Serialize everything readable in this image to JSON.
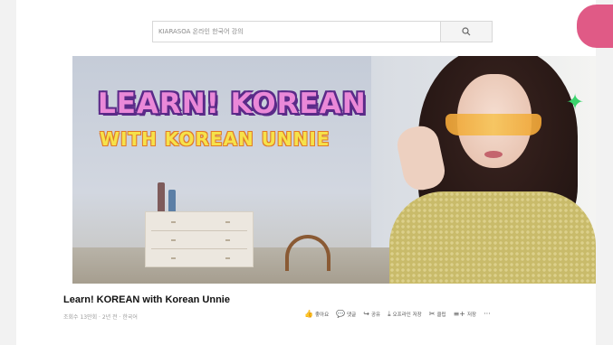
{
  "search": {
    "query": "KIARASOA 온라인 한국어 강의",
    "button_icon": "search-icon"
  },
  "video": {
    "thumbnail_title_line1": "LEARN! KOREAN",
    "thumbnail_title_line2": "WITH KOREAN UNNIE",
    "sparkle_icon": "sparkle-icon"
  },
  "info": {
    "title": "Learn! KOREAN with Korean Unnie",
    "meta": "조회수 13만회 · 2년 전 · 한국어"
  },
  "actions": [
    {
      "icon": "thumbs-up-icon",
      "glyph": "👍",
      "label": "좋아요"
    },
    {
      "icon": "comment-icon",
      "glyph": "💬",
      "label": "댓글"
    },
    {
      "icon": "share-icon",
      "glyph": "↪",
      "label": "공유"
    },
    {
      "icon": "download-icon",
      "glyph": "⤓",
      "label": "오프라인 저장"
    },
    {
      "icon": "clip-icon",
      "glyph": "✂",
      "label": "클립"
    },
    {
      "icon": "save-icon",
      "glyph": "≡+",
      "label": "저장"
    },
    {
      "icon": "more-icon",
      "glyph": "···",
      "label": ""
    }
  ],
  "colors": {
    "badge": "#e05a86",
    "title_pink": "#ea88d8",
    "title_yellow": "#f6e24a"
  }
}
